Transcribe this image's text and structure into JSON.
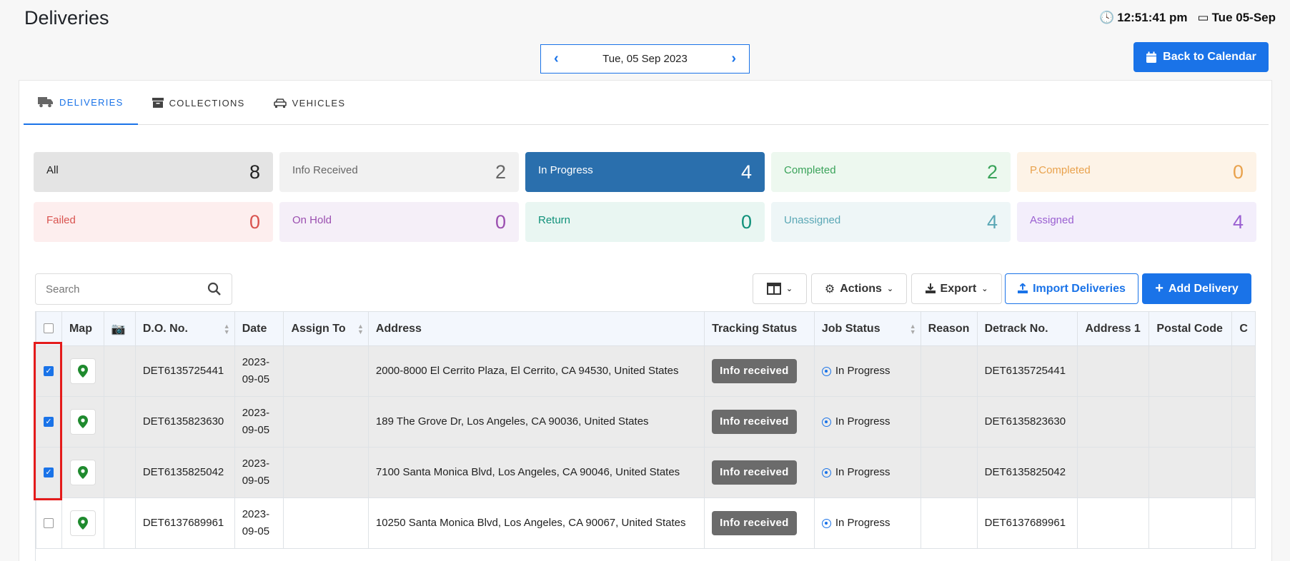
{
  "header": {
    "title": "Deliveries",
    "time": "12:51:41 pm",
    "date": "Tue 05-Sep"
  },
  "date_nav": {
    "prev": "‹",
    "next": "›",
    "current": "Tue, 05 Sep 2023"
  },
  "back_button": {
    "label": "Back to Calendar",
    "icon": "calendar-icon"
  },
  "tabs": [
    {
      "label": "DELIVERIES",
      "icon": "truck-icon",
      "active": true
    },
    {
      "label": "COLLECTIONS",
      "icon": "archive-icon",
      "active": false
    },
    {
      "label": "VEHICLES",
      "icon": "car-icon",
      "active": false
    }
  ],
  "stats": [
    {
      "label": "All",
      "count": "8",
      "bg": "#e4e4e4",
      "color": "#222"
    },
    {
      "label": "Info Received",
      "count": "2",
      "bg": "#f1f1f1",
      "color": "#666"
    },
    {
      "label": "In Progress",
      "count": "4",
      "bg": "#2a6fad",
      "color": "#ffffff"
    },
    {
      "label": "Completed",
      "count": "2",
      "bg": "#edf8ef",
      "color": "#3aa35a"
    },
    {
      "label": "P.Completed",
      "count": "0",
      "bg": "#fdf3e7",
      "color": "#e9a24d"
    },
    {
      "label": "Failed",
      "count": "0",
      "bg": "#fdeeee",
      "color": "#d9534f"
    },
    {
      "label": "On Hold",
      "count": "0",
      "bg": "#f5eff8",
      "color": "#9b4fb0"
    },
    {
      "label": "Return",
      "count": "0",
      "bg": "#e9f6f2",
      "color": "#10917a"
    },
    {
      "label": "Unassigned",
      "count": "4",
      "bg": "#eef6f7",
      "color": "#5aa7b5"
    },
    {
      "label": "Assigned",
      "count": "4",
      "bg": "#f3eefb",
      "color": "#9a5fd1"
    }
  ],
  "toolbar": {
    "search_placeholder": "Search",
    "columns_icon": "columns-icon",
    "actions_label": "Actions",
    "export_label": "Export",
    "import_label": "Import Deliveries",
    "add_label": "Add Delivery"
  },
  "table": {
    "columns": [
      "",
      "Map",
      "",
      "D.O. No.",
      "Date",
      "Assign To",
      "Address",
      "Tracking Status",
      "Job Status",
      "Reason",
      "Detrack No.",
      "Address 1",
      "Postal Code",
      "C"
    ],
    "rows": [
      {
        "checked": true,
        "do_no": "DET6135725441",
        "date": "2023-\n09-05",
        "assign_to": "",
        "address": "2000-8000 El Cerrito Plaza, El Cerrito, CA 94530, United States",
        "tracking": "Info received",
        "job": "In Progress",
        "reason": "",
        "detrack": "DET6135725441",
        "address1": "",
        "postal": ""
      },
      {
        "checked": true,
        "do_no": "DET6135823630",
        "date": "2023-\n09-05",
        "assign_to": "",
        "address": "189 The Grove Dr, Los Angeles, CA 90036, United States",
        "tracking": "Info received",
        "job": "In Progress",
        "reason": "",
        "detrack": "DET6135823630",
        "address1": "",
        "postal": ""
      },
      {
        "checked": true,
        "do_no": "DET6135825042",
        "date": "2023-\n09-05",
        "assign_to": "",
        "address": "7100 Santa Monica Blvd, Los Angeles, CA 90046, United States",
        "tracking": "Info received",
        "job": "In Progress",
        "reason": "",
        "detrack": "DET6135825042",
        "address1": "",
        "postal": ""
      },
      {
        "checked": false,
        "do_no": "DET6137689961",
        "date": "2023-\n09-05",
        "assign_to": "",
        "address": "10250 Santa Monica Blvd, Los Angeles, CA 90067, United States",
        "tracking": "Info received",
        "job": "In Progress",
        "reason": "",
        "detrack": "DET6137689961",
        "address1": "",
        "postal": ""
      }
    ]
  },
  "colors": {
    "accent": "#1a73e8",
    "highlight": "#e41b1b",
    "badge": "#6b6b6b",
    "pin": "#1f8a2e"
  }
}
